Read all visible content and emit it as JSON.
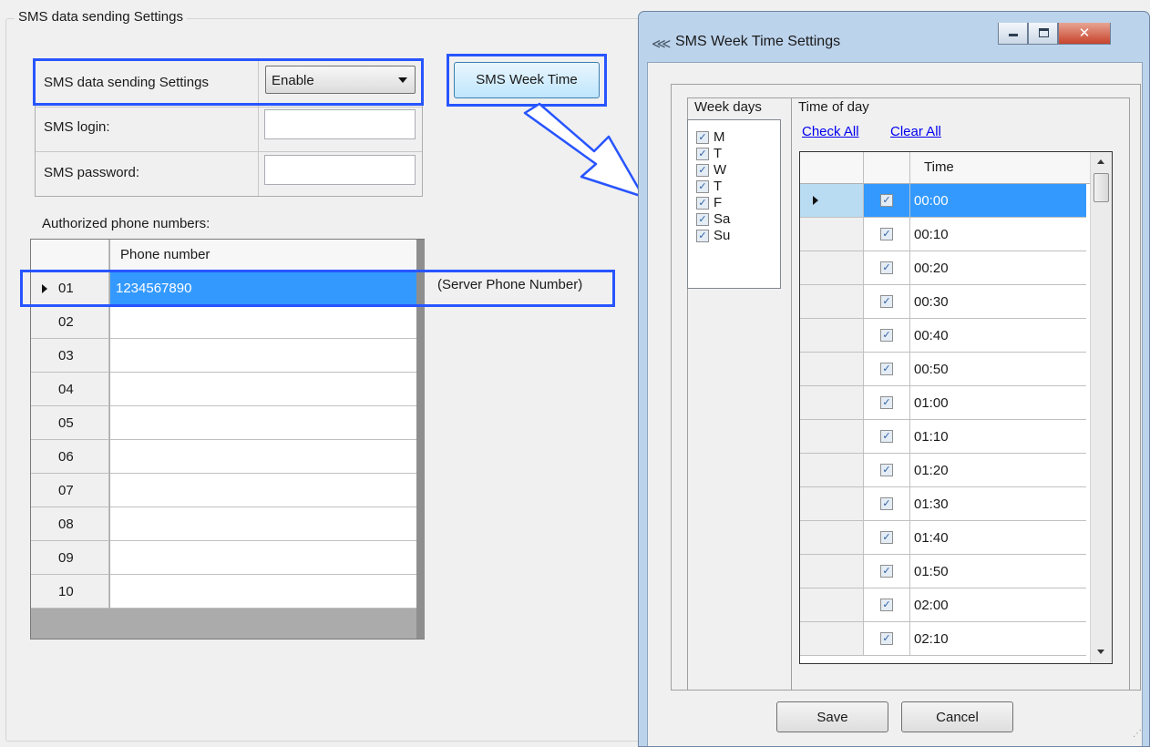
{
  "main": {
    "group_title": "SMS data sending Settings",
    "settings": {
      "enable_label": "SMS data sending Settings",
      "enable_value": "Enable",
      "login_label": "SMS login:",
      "login_value": "",
      "password_label": "SMS password:",
      "password_value": ""
    },
    "week_time_button": "SMS Week Time",
    "authorized_label": "Authorized phone numbers:",
    "phone_grid": {
      "column_header": "Phone number",
      "rows": [
        {
          "index": "01",
          "number": "1234567890",
          "selected": true
        },
        {
          "index": "02",
          "number": ""
        },
        {
          "index": "03",
          "number": ""
        },
        {
          "index": "04",
          "number": ""
        },
        {
          "index": "05",
          "number": ""
        },
        {
          "index": "06",
          "number": ""
        },
        {
          "index": "07",
          "number": ""
        },
        {
          "index": "08",
          "number": ""
        },
        {
          "index": "09",
          "number": ""
        },
        {
          "index": "10",
          "number": ""
        }
      ]
    },
    "server_note": "(Server Phone Number)",
    "highlight_color": "#2855ff"
  },
  "dialog": {
    "title": "SMS Week Time Settings",
    "icon": "app-arrows-icon",
    "caption_buttons": [
      "minimize-icon",
      "maximize-icon",
      "close-icon"
    ],
    "week_days_header": "Week days",
    "week_days": [
      {
        "label": "M",
        "checked": true
      },
      {
        "label": "T",
        "checked": true
      },
      {
        "label": "W",
        "checked": true
      },
      {
        "label": "T",
        "checked": true
      },
      {
        "label": "F",
        "checked": true
      },
      {
        "label": "Sa",
        "checked": true
      },
      {
        "label": "Su",
        "checked": true
      }
    ],
    "time_of_day_header": "Time of day",
    "check_all": "Check All",
    "clear_all": "Clear All",
    "time_grid": {
      "time_header": "Time",
      "rows": [
        {
          "time": "00:00",
          "checked": true,
          "selected": true
        },
        {
          "time": "00:10",
          "checked": true
        },
        {
          "time": "00:20",
          "checked": true
        },
        {
          "time": "00:30",
          "checked": true
        },
        {
          "time": "00:40",
          "checked": true
        },
        {
          "time": "00:50",
          "checked": true
        },
        {
          "time": "01:00",
          "checked": true
        },
        {
          "time": "01:10",
          "checked": true
        },
        {
          "time": "01:20",
          "checked": true
        },
        {
          "time": "01:30",
          "checked": true
        },
        {
          "time": "01:40",
          "checked": true
        },
        {
          "time": "01:50",
          "checked": true
        },
        {
          "time": "02:00",
          "checked": true
        },
        {
          "time": "02:10",
          "checked": true
        }
      ]
    },
    "save": "Save",
    "cancel": "Cancel",
    "selection_color": "#3399ff"
  }
}
